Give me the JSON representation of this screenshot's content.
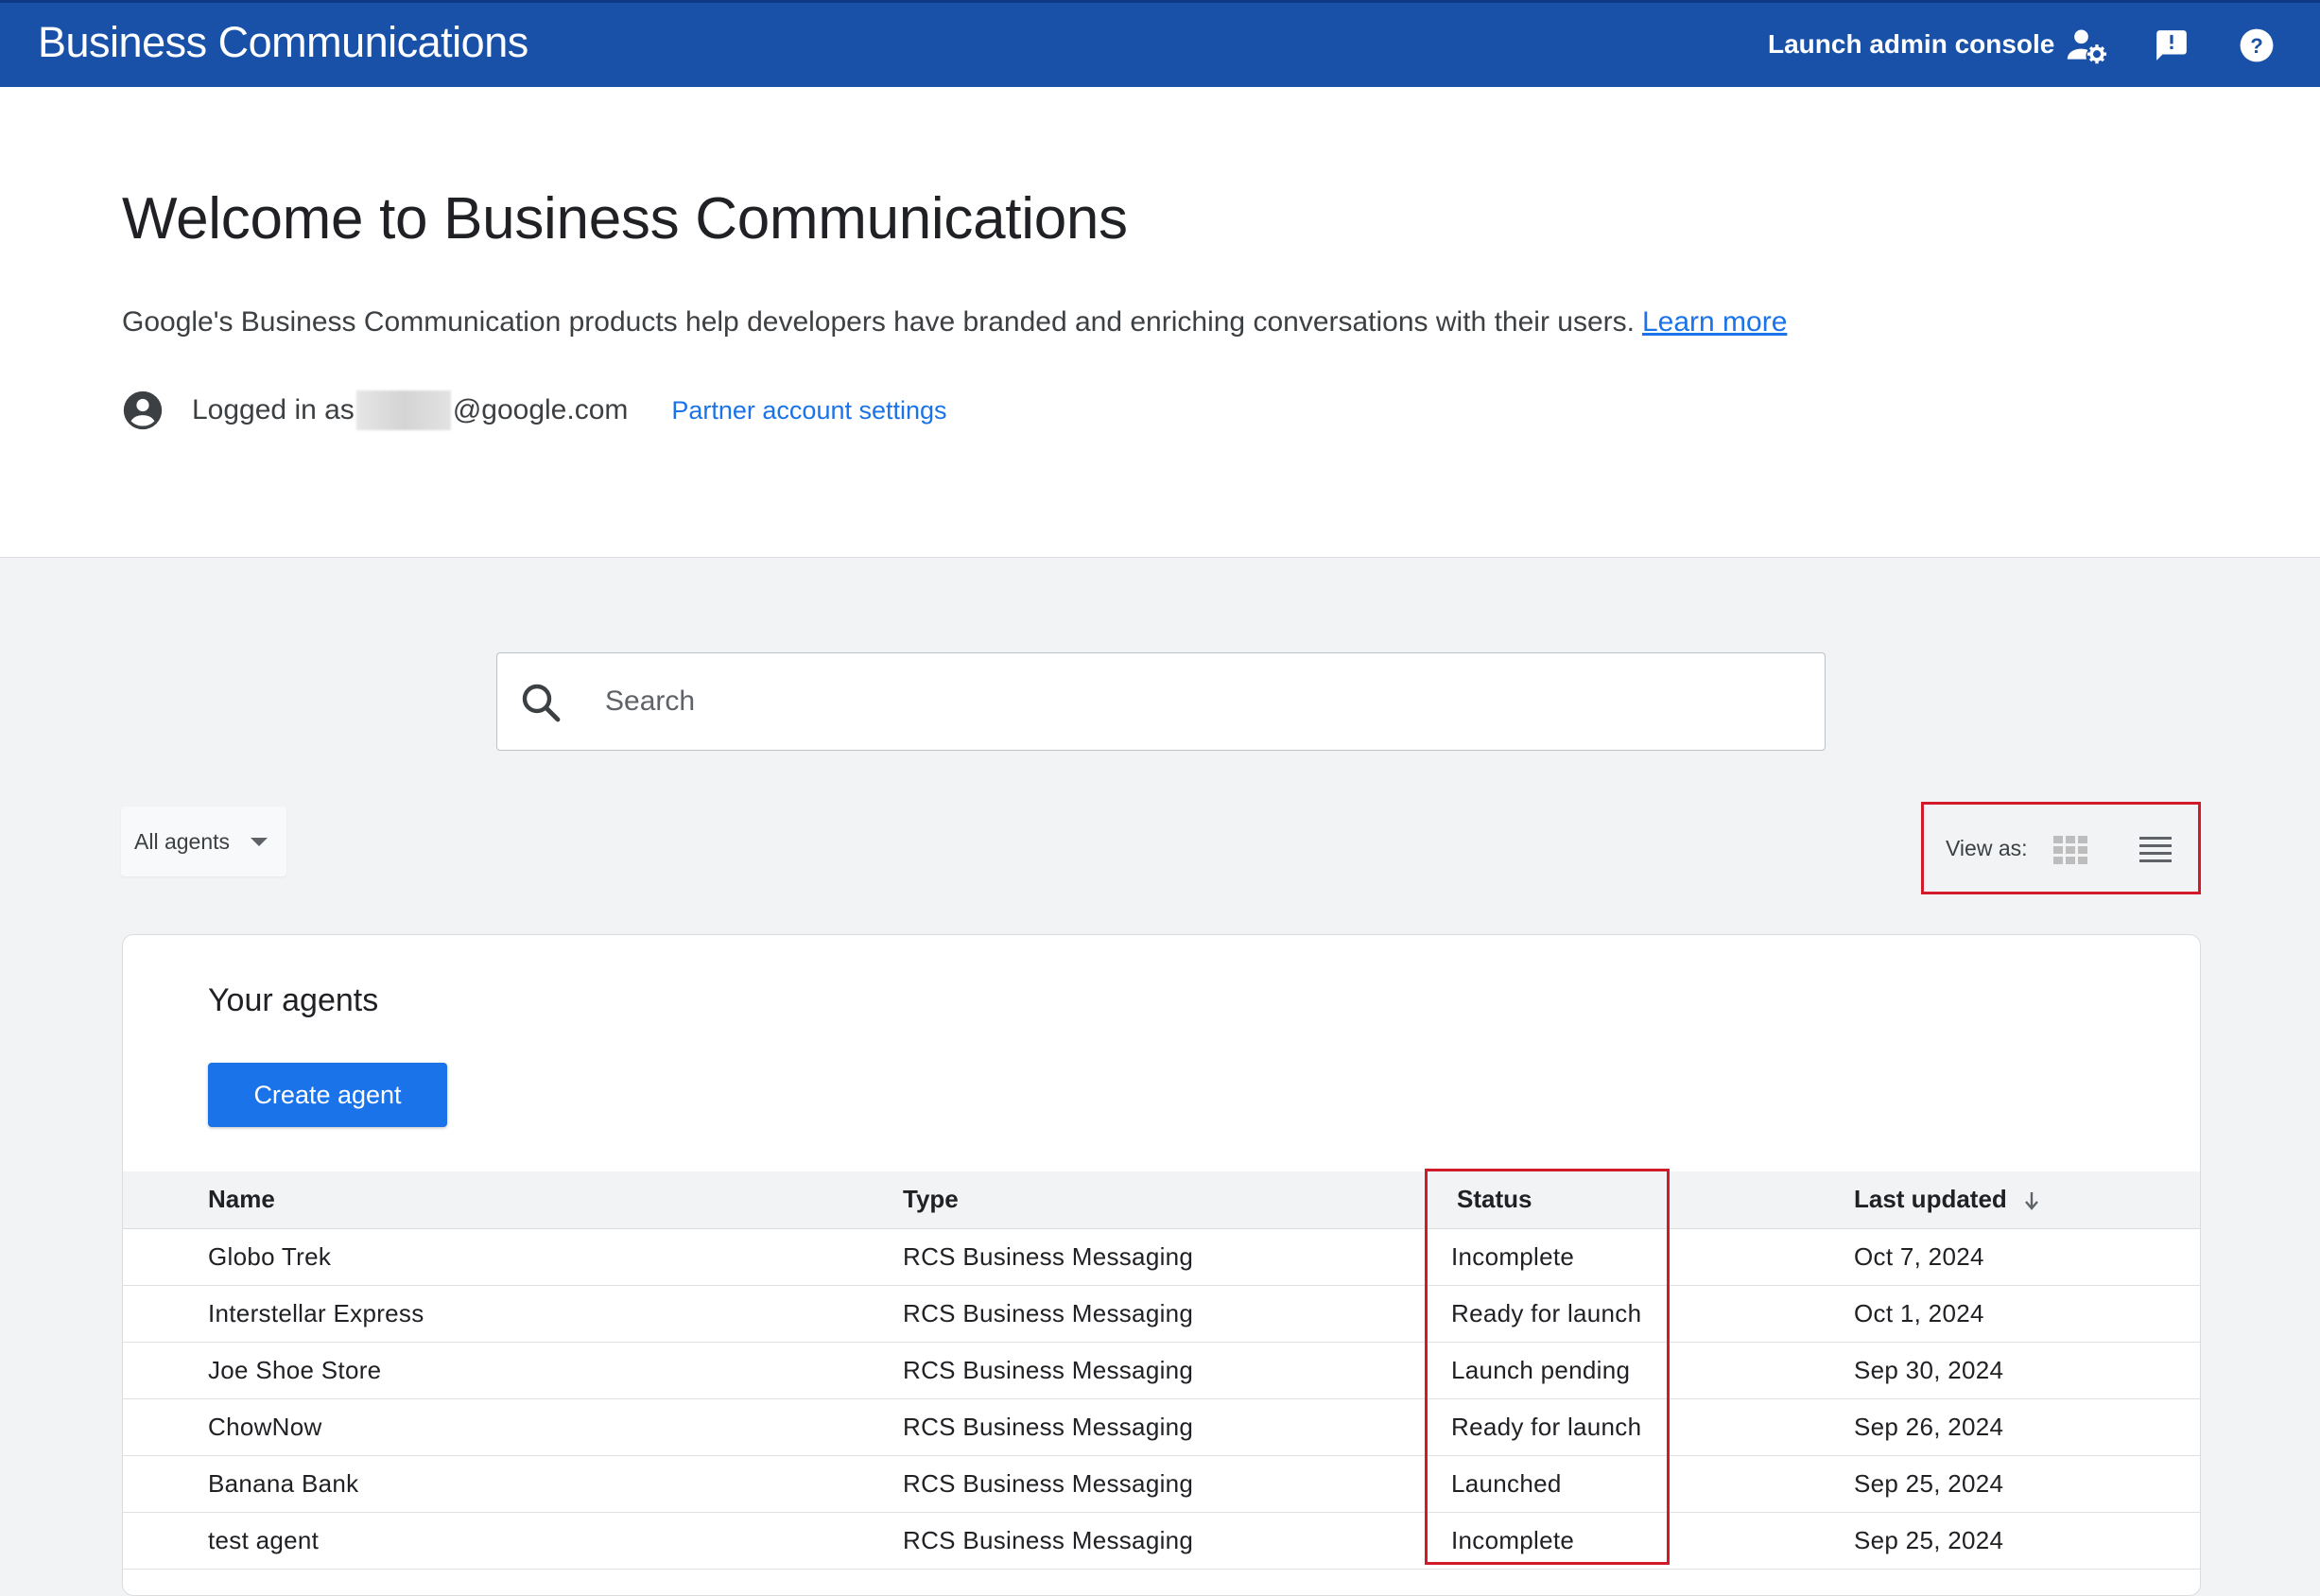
{
  "header": {
    "app_title": "Business Communications",
    "admin_console_label": "Launch admin console",
    "icons": [
      "admin-settings-icon",
      "feedback-icon",
      "help-icon"
    ],
    "brand_color": "#1a51a8"
  },
  "hero": {
    "welcome_title": "Welcome to Business Communications",
    "description": "Google's Business Communication products help developers have branded and enriching conversations with their users.",
    "learn_more_label": "Learn more",
    "logged_in_prefix": "Logged in as",
    "email_suffix": "@google.com",
    "partner_settings_label": "Partner account settings"
  },
  "search": {
    "placeholder": "Search"
  },
  "filter": {
    "selected": "All agents"
  },
  "view_toggle": {
    "label": "View as:",
    "options": [
      "grid-view-icon",
      "list-view-icon"
    ],
    "highlight_color": "#d11a2a"
  },
  "agents_card": {
    "title": "Your agents",
    "create_button_label": "Create agent",
    "accent_color": "#1a73e8",
    "columns": {
      "name": "Name",
      "type": "Type",
      "status": "Status",
      "last_updated": "Last updated"
    },
    "rows": [
      {
        "name": "Globo Trek",
        "type": "RCS Business Messaging",
        "status": "Incomplete",
        "last_updated": "Oct 7, 2024"
      },
      {
        "name": "Interstellar Express",
        "type": "RCS Business Messaging",
        "status": "Ready for launch",
        "last_updated": "Oct 1, 2024"
      },
      {
        "name": "Joe Shoe Store",
        "type": "RCS Business Messaging",
        "status": "Launch pending",
        "last_updated": "Sep 30, 2024"
      },
      {
        "name": "ChowNow",
        "type": "RCS Business Messaging",
        "status": "Ready for launch",
        "last_updated": "Sep 26, 2024"
      },
      {
        "name": "Banana Bank",
        "type": "RCS Business Messaging",
        "status": "Launched",
        "last_updated": "Sep 25, 2024"
      },
      {
        "name": "test agent",
        "type": "RCS Business Messaging",
        "status": "Incomplete",
        "last_updated": "Sep 25, 2024"
      }
    ]
  }
}
